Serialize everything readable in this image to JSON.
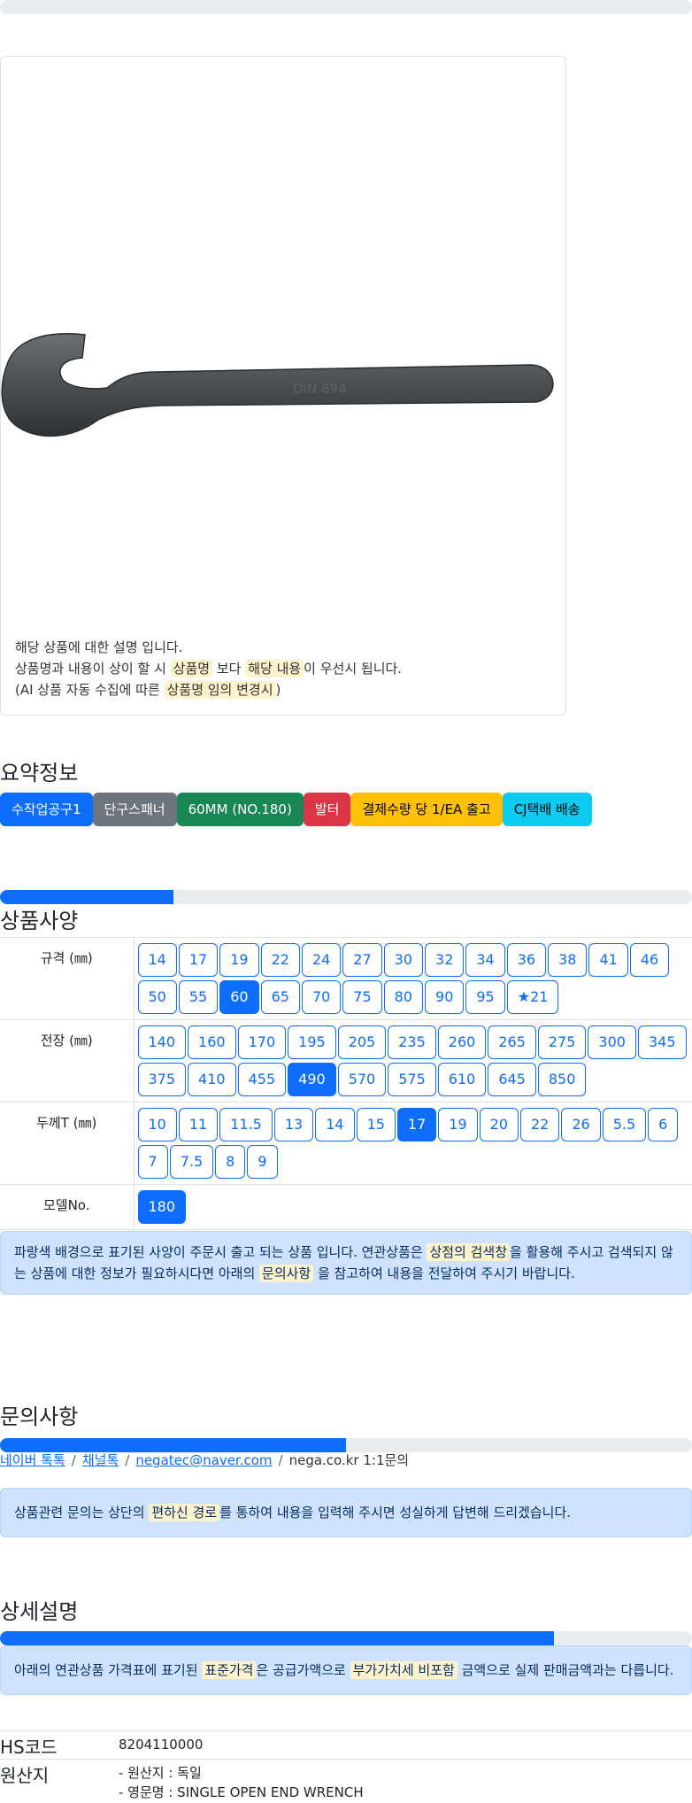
{
  "product": {
    "description": [
      "해당 상품에 대한 설명 입니다.",
      [
        "상품명과 내용이 상이 할 시 ",
        "상품명",
        " 보다 ",
        "해당 내용",
        "이 우선시 됩니다."
      ],
      [
        "(AI 상품 자동 수집에 따른 ",
        "상품명 임의 변경시",
        ")"
      ]
    ],
    "image_text": [
      "DIN 894"
    ]
  },
  "summary": {
    "title": "요약정보",
    "badges": [
      {
        "label": "수작업공구1",
        "color": "#0d6efd",
        "text_color": "#ffffff"
      },
      {
        "label": "단구스패너",
        "color": "#6c757d",
        "text_color": "#ffffff"
      },
      {
        "label": "60MM (NO.180)",
        "color": "#198754",
        "text_color": "#ffffff"
      },
      {
        "label": "발터",
        "color": "#dc3545",
        "text_color": "#ffffff"
      },
      {
        "label": "결제수량 당 1/EA 출고",
        "color": "#ffc107",
        "text_color": "#000000"
      },
      {
        "label": "CJ택배 배송",
        "color": "#0dcaf0",
        "text_color": "#000000"
      }
    ]
  },
  "specs": {
    "title": "상품사양",
    "progress": 0.25,
    "rows": [
      {
        "label": "규격 (㎜)",
        "selected": "60",
        "options": [
          "14",
          "17",
          "19",
          "22",
          "24",
          "27",
          "30",
          "32",
          "34",
          "36",
          "38",
          "41",
          "46",
          "50",
          "55",
          "60",
          "65",
          "70",
          "75",
          "80",
          "90",
          "95",
          "★21"
        ]
      },
      {
        "label": "전장 (㎜)",
        "selected": "490",
        "options": [
          "140",
          "160",
          "170",
          "195",
          "205",
          "235",
          "260",
          "265",
          "275",
          "300",
          "345",
          "375",
          "410",
          "455",
          "490",
          "570",
          "575",
          "610",
          "645",
          "850"
        ]
      },
      {
        "label": "두께T (㎜)",
        "selected": "17",
        "options": [
          "10",
          "11",
          "11.5",
          "13",
          "14",
          "15",
          "17",
          "19",
          "20",
          "22",
          "26",
          "5.5",
          "6",
          "7",
          "7.5",
          "8",
          "9"
        ]
      },
      {
        "label": "모델No.",
        "selected": "180",
        "options": [
          "180"
        ]
      }
    ],
    "notice": [
      "파랑색 배경으로 표기된 사양이 주문시 출고 되는 상품 입니다. 연관상품은 ",
      "상점의 검색창",
      "을 활용해 주시고 검색되지 않는 상품에 대한 정보가 필요하시다면 아래의 ",
      "문의사항",
      " 을 참고하여 내용을 전달하여 주시기 바랍니다."
    ]
  },
  "inquiry": {
    "title": "문의사항",
    "progress": 0.5,
    "links": [
      "네이버 톡톡",
      "채널톡",
      "negatec@naver.com"
    ],
    "plain": "nega.co.kr 1:1문의",
    "notice": [
      "상품관련 문의는 상단의 ",
      "편하신 경로",
      "를 통하여 내용을 입력해 주시면 성실하게 답변해 드리겠습니다."
    ]
  },
  "detail": {
    "title": "상세설명",
    "progress": 0.8,
    "notice": [
      "아래의 연관상품 가격표에 표기된 ",
      "표준가격",
      "은 공급가액으로 ",
      "부가가치세 비포함",
      " 금액으로 실제 판매금액과는 다릅니다."
    ],
    "rows": [
      {
        "key": "HS코드",
        "values": [
          "8204110000"
        ]
      },
      {
        "key": "원산지",
        "values": [
          "- 원산지 : 독일",
          "- 영문명 : SINGLE OPEN END WRENCH"
        ]
      }
    ]
  }
}
